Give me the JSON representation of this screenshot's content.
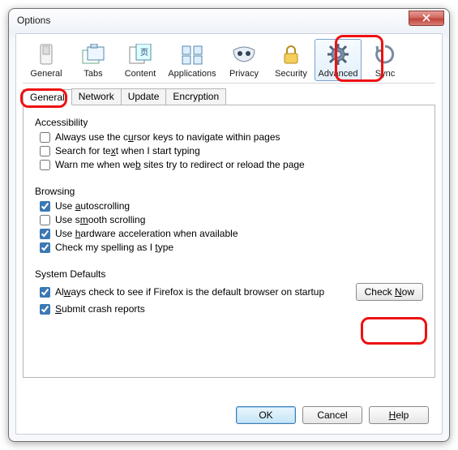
{
  "window": {
    "title": "Options"
  },
  "categories": {
    "general": "General",
    "tabs": "Tabs",
    "content": "Content",
    "applications": "Applications",
    "privacy": "Privacy",
    "security": "Security",
    "advanced": "Advanced",
    "sync": "Sync"
  },
  "subtabs": {
    "general": "General",
    "network": "Network",
    "update": "Update",
    "encryption": "Encryption"
  },
  "groups": {
    "accessibility": "Accessibility",
    "browsing": "Browsing",
    "system_defaults": "System Defaults"
  },
  "options": {
    "cursor_keys": "Always use the cursor keys to navigate within pages",
    "search_text": "Search for text when I start typing",
    "warn_redirect": "Warn me when web sites try to redirect or reload the page",
    "autoscroll": "Use autoscrolling",
    "smooth": "Use smooth scrolling",
    "hwaccel": "Use hardware acceleration when available",
    "spelling": "Check my spelling as I type",
    "default_browser": "Always check to see if Firefox is the default browser on startup",
    "crash": "Submit crash reports"
  },
  "checked": {
    "cursor_keys": false,
    "search_text": false,
    "warn_redirect": false,
    "autoscroll": true,
    "smooth": false,
    "hwaccel": true,
    "spelling": true,
    "default_browser": true,
    "crash": true
  },
  "buttons": {
    "check_now": "Check Now",
    "ok": "OK",
    "cancel": "Cancel",
    "help": "Help"
  }
}
